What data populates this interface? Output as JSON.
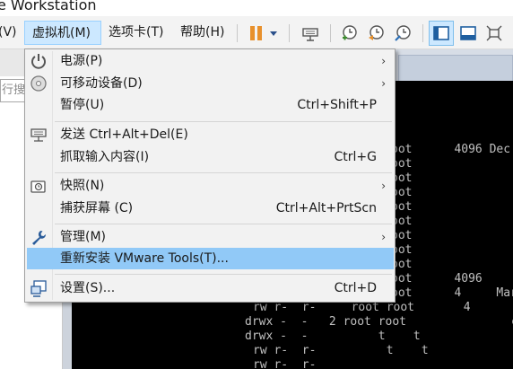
{
  "window": {
    "title": "e Workstation"
  },
  "menubar": {
    "items": [
      {
        "label": "(V)"
      },
      {
        "label": "虚拟机(M)"
      },
      {
        "label": "选项卡(T)"
      },
      {
        "label": "帮助(H)"
      }
    ]
  },
  "toolbar": {
    "icons": [
      "pause-icon",
      "dropdown-arrow-icon",
      "send-ctrl-alt-del-icon",
      "snapshot-take-icon",
      "snapshot-revert-icon",
      "snapshot-manager-icon",
      "console-view-icon",
      "fit-guest-icon",
      "full-screen-icon"
    ],
    "accent": "#e8912d"
  },
  "library": {
    "search_placeholder": "行搜"
  },
  "vm_menu": {
    "items": [
      {
        "label": "电源(P)",
        "shortcut": "",
        "submenu": true,
        "icon": "power-icon"
      },
      {
        "label": "可移动设备(D)",
        "shortcut": "",
        "submenu": true,
        "icon": "removable-disc-icon"
      },
      {
        "label": "暂停(U)",
        "shortcut": "Ctrl+Shift+P",
        "submenu": false,
        "icon": ""
      },
      {
        "label": "发送 Ctrl+Alt+Del(E)",
        "shortcut": "",
        "submenu": false,
        "icon": "keyboard-network-icon"
      },
      {
        "label": "抓取输入内容(I)",
        "shortcut": "Ctrl+G",
        "submenu": false,
        "icon": ""
      },
      {
        "label": "快照(N)",
        "shortcut": "",
        "submenu": true,
        "icon": "snapshot-icon"
      },
      {
        "label": "捕获屏幕 (C)",
        "shortcut": "Ctrl+Alt+PrtScn",
        "submenu": false,
        "icon": ""
      },
      {
        "label": "管理(M)",
        "shortcut": "",
        "submenu": true,
        "icon": "wrench-icon"
      },
      {
        "label": "重新安装 VMware Tools(T)...",
        "shortcut": "",
        "submenu": false,
        "icon": "",
        "highlighted": true
      },
      {
        "label": "设置(S)...",
        "shortcut": "Ctrl+D",
        "submenu": false,
        "icon": "settings-icon"
      }
    ],
    "highlight_color": "#91c9f7"
  },
  "console": {
    "lines": [
      "oot      4096 Dec",
      "oot",
      "oot",
      "oot               e",
      "oot               e",
      "oot",
      "oot",
      "oot               Dec",
      "oot",
      "oot      4096",
      "oot      4     Mar",
      "rw r-  r-     root root       4",
      "drwx -  -   2 root root               e",
      "drwx -  -          t    t",
      "rw r-  r-          t    t",
      "rw r-  r-"
    ]
  }
}
